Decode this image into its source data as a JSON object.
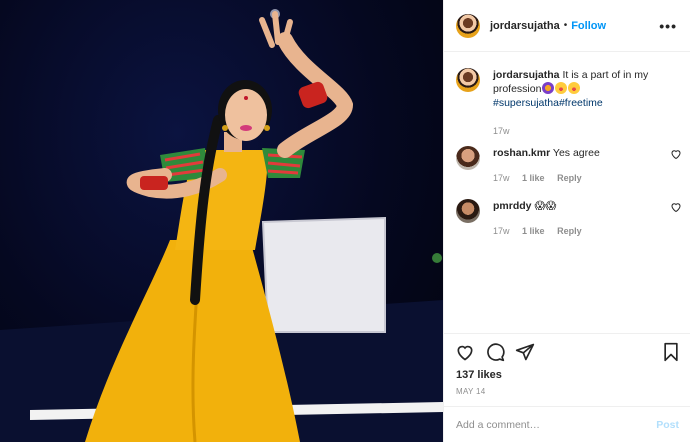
{
  "post": {
    "username": "jordarsujatha",
    "follow_label": "Follow",
    "separator": "•",
    "more_label": "•••",
    "caption_text": "It is a part of in my profession",
    "hashtags": "#supersujatha#freetime",
    "caption_time": "17w",
    "likes": "137 likes",
    "date": "MAY 14"
  },
  "comments": [
    {
      "user": "roshan.kmr",
      "text": "Yes agree",
      "time": "17w",
      "likes": "1 like",
      "reply": "Reply"
    },
    {
      "user": "pmrddy",
      "text": "😱😱",
      "time": "17w",
      "likes": "1 like",
      "reply": "Reply"
    }
  ],
  "add_comment": {
    "placeholder": "Add a comment…",
    "post_label": "Post"
  },
  "icons": {
    "more": "more-horizontal-icon",
    "heart": "heart-icon",
    "comment": "comment-icon",
    "share": "share-icon",
    "bookmark": "bookmark-icon",
    "comment_like": "small-heart-icon"
  },
  "colors": {
    "follow": "#0095f6",
    "hashtag": "#00376b",
    "muted": "#8e8e8e",
    "post_disabled": "#b2dffc"
  }
}
